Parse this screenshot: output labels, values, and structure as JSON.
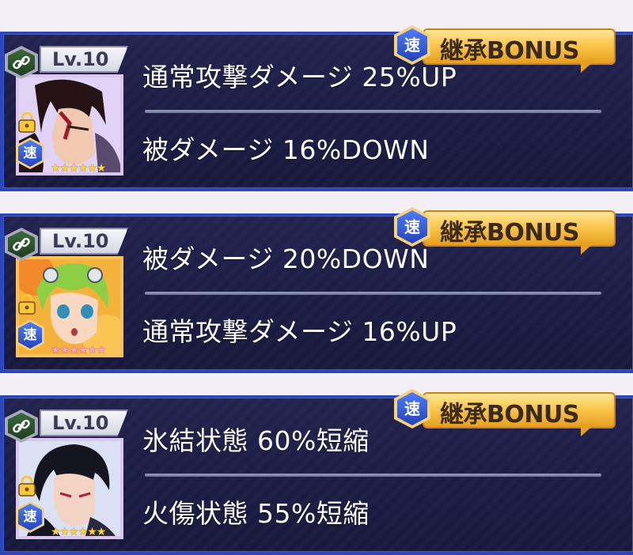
{
  "cards": [
    {
      "level": "Lv.10",
      "speed_badge": "速",
      "bonus_label": "継承BONUS",
      "skill_top": "通常攻撃ダメージ 25%UP",
      "skill_bottom": "被ダメージ 16%DOWN",
      "stars": "★★★★★★",
      "star_color": "gold",
      "portrait_palette": {
        "bg": "#d8c6f2",
        "hair": "#241214",
        "skin": "#f1c9b0",
        "accent": "#9b1c2a"
      }
    },
    {
      "level": "Lv.10",
      "speed_badge": "速",
      "bonus_label": "継承BONUS",
      "skill_top": "被ダメージ 20%DOWN",
      "skill_bottom": "通常攻撃ダメージ 16%UP",
      "stars": "★★★★★★",
      "star_color": "pink",
      "portrait_palette": {
        "bg": "#f4b23a",
        "hair": "#8ccf45",
        "skin": "#f8d8c0",
        "accent": "#f06a20"
      }
    },
    {
      "level": "Lv.10",
      "speed_badge": "速",
      "bonus_label": "継承BONUS",
      "skill_top": "氷結状態 60%短縮",
      "skill_bottom": "火傷状態 55%短縮",
      "stars": "★★★★★★",
      "star_color": "gold",
      "portrait_palette": {
        "bg": "#cfd7f0",
        "hair": "#151520",
        "skin": "#f3d3c3",
        "accent": "#b02038"
      }
    }
  ],
  "colors": {
    "panel_border": "#2c46b8",
    "panel_bg": "#1c1d44",
    "bonus_gold": "#f9c64b",
    "speed_blue": "#2443b8"
  },
  "icons": [
    "link-icon",
    "lock-icon",
    "speed-icon",
    "star-icon"
  ]
}
